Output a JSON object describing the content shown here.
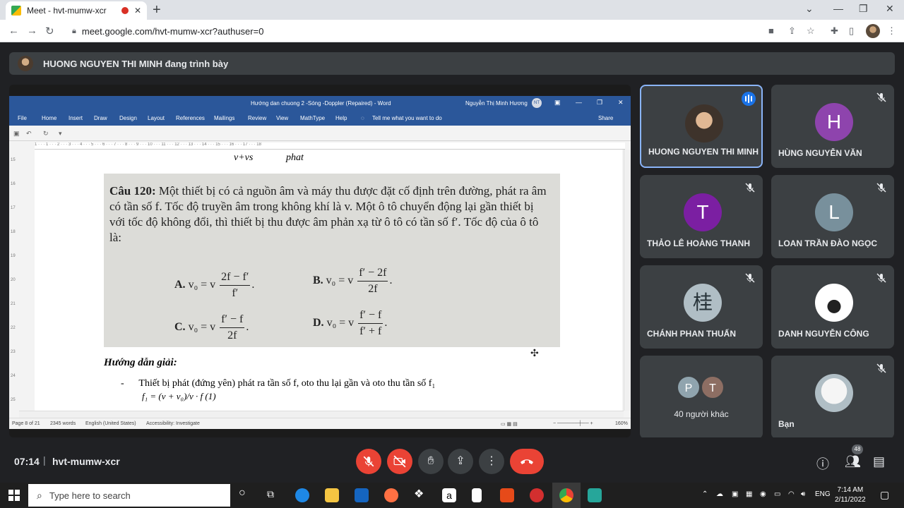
{
  "browser": {
    "tab_title": "Meet - hvt-mumw-xcr",
    "tab_close": "✕",
    "new_tab": "+",
    "url": "meet.google.com/hvt-mumw-xcr?authuser=0"
  },
  "meet": {
    "presenter_text": "HUONG NGUYEN THI MINH đang trình bày",
    "time": "07:14",
    "separator": "|",
    "meeting_code": "hvt-mumw-xcr",
    "participants_badge": "48"
  },
  "word": {
    "doc_title": "Hướng dan chuong 2 -Sóng -Doppler (Repaired) - Word",
    "user": "Nguyễn Thị Minh Hương",
    "user_initials": "NT",
    "tell_me": "Tell me what you want to do",
    "share": "Share",
    "ribbon": [
      "File",
      "Home",
      "Insert",
      "Draw",
      "Design",
      "Layout",
      "References",
      "Mailings",
      "Review",
      "View",
      "MathType",
      "Help"
    ],
    "status": {
      "page": "Page 8 of 21",
      "words": "2345 words",
      "lang": "English (United States)",
      "accessibility": "Accessibility: Investigate",
      "zoom": "160%"
    },
    "ruler_marks": "1 · · · 1 · · · 2 · · · 3 · · · 4 · · · 5 · · · 6 · · · 7 · · · 8 · · · 9 · · · 10 · · · 11 · · · 12 · · · 13 · · · 14 · · · 15 · · · 16 · · · 17 · · · 18",
    "vruler": [
      "15",
      "16",
      "17",
      "18",
      "19",
      "20",
      "21",
      "22",
      "23",
      "24",
      "25"
    ],
    "page": {
      "prev_formula_a": "v+vs",
      "prev_formula_b": "phat",
      "question_label": "Câu 120:",
      "question_text": "Một thiết bị có cả nguồn âm và máy thu được đặt cố định trên đường, phát ra âm có tần số f. Tốc độ truyền âm trong không khí là v. Một ô tô chuyển động lại gần thiết bị với tốc độ không đổi, thì thiết bị thu được âm phản xạ từ ô tô có tần số f′. Tốc độ của ô tô là:",
      "options": {
        "a_label": "A.",
        "a_lhs": "v₀ = v",
        "a_num": "2f − f′",
        "a_den": "f′",
        "b_label": "B.",
        "b_lhs": "v₀ = v",
        "b_num": "f′ − 2f",
        "b_den": "2f",
        "c_label": "C.",
        "c_lhs": "v₀ = v",
        "c_num": "f′ − f",
        "c_den": "2f",
        "d_label": "D.",
        "d_lhs": "v₀ = v",
        "d_num": "f′ − f",
        "d_den": "f′ + f"
      },
      "heading": "Hướng dẫn giải:",
      "bullet": "-",
      "line1": "Thiết bị phát (đứng yên) phát ra tần số f, oto thu lại gần và oto thu tần số f₁",
      "line2": "f₁ = (v + v₀)/v · f  (1)"
    }
  },
  "tiles": [
    {
      "name": "HUONG NGUYEN THI MINH",
      "initial": "",
      "color": "#6b5a4a",
      "speaking": true
    },
    {
      "name": "HÙNG NGUYỄN VĂN",
      "initial": "H",
      "color": "#8e44ad",
      "muted": true
    },
    {
      "name": "THẢO LÊ HOÀNG THANH",
      "initial": "T",
      "color": "#7b1fa2",
      "muted": true
    },
    {
      "name": "LOAN TRẦN ĐÀO NGỌC",
      "initial": "L",
      "color": "#78909c",
      "muted": true
    },
    {
      "name": "CHÁNH PHAN THUẤN",
      "initial": "桂",
      "color": "#90a4ae",
      "muted": true
    },
    {
      "name": "DANH NGUYỄN CÔNG",
      "initial": "",
      "color": "#ffffff",
      "muted": true
    },
    {
      "name": "40 người khác",
      "others": [
        "P",
        "T"
      ]
    },
    {
      "name": "Bạn",
      "initial": "",
      "color": "#cfd8dc",
      "muted": true
    }
  ],
  "taskbar": {
    "search_placeholder": "Type here to search",
    "lang": "ENG",
    "time": "7:14 AM",
    "date": "2/11/2022"
  },
  "colors": {
    "word_blue": "#2b579a",
    "meet_bg": "#202124",
    "tile_bg": "#3c4043",
    "end_call": "#ea4335",
    "active_border": "#8ab4f8"
  }
}
